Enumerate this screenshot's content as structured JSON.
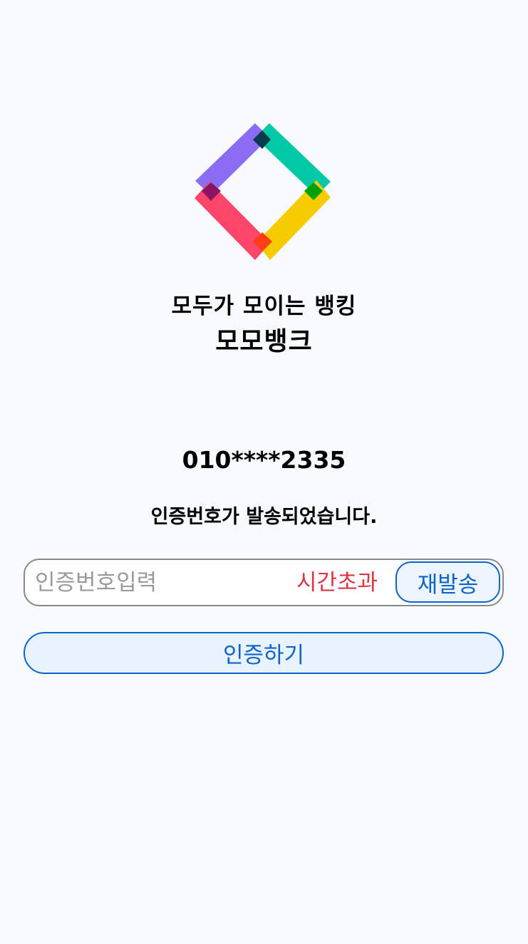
{
  "logo": {
    "name": "momo-bank-logo",
    "colors": {
      "purple": "#8a6cf5",
      "teal": "#00c9a7",
      "pink": "#ff466a",
      "yellow": "#f6cb00",
      "overlap_top": "#073b4c",
      "overlap_right": "#00a100",
      "overlap_left": "#8a1565",
      "overlap_bottom": "#ff3e16"
    }
  },
  "header": {
    "tagline": "모두가 모이는 뱅킹",
    "brand": "모모뱅크"
  },
  "verification": {
    "phone_number": "010****2335",
    "sent_message": "인증번호가 발송되었습니다.",
    "code_input": {
      "value": "",
      "placeholder": "인증번호입력"
    },
    "timer_status": "시간초과",
    "resend_label": "재발송",
    "verify_label": "인증하기"
  },
  "colors": {
    "background": "#f7faff",
    "accent": "#0d64c8",
    "error": "#dc3545",
    "input_border": "#888888"
  }
}
